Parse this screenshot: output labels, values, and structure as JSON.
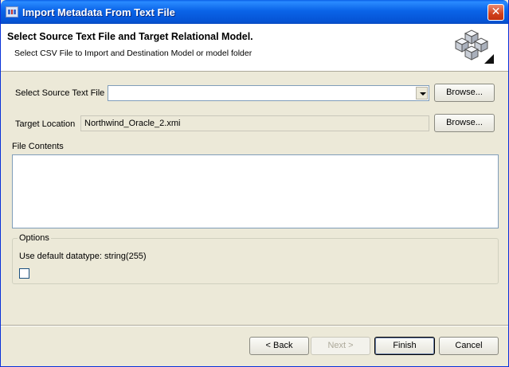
{
  "window": {
    "title": "Import Metadata From Text File",
    "close_glyph": "✕"
  },
  "banner": {
    "heading": "Select Source Text File and Target Relational Model.",
    "subtitle": "Select CSV File to Import and Destination Model or model folder",
    "icon": "cubes-icon"
  },
  "source": {
    "label": "Select Source Text File",
    "value": "",
    "browse_label": "Browse..."
  },
  "target": {
    "label": "Target Location",
    "value": "Northwind_Oracle_2.xmi",
    "browse_label": "Browse..."
  },
  "file_contents": {
    "label": "File Contents",
    "value": ""
  },
  "options": {
    "legend": "Options",
    "default_datatype_label": "Use default datatype: string(255)",
    "use_default_checked": false
  },
  "buttons": {
    "back": "< Back",
    "next": "Next >",
    "finish": "Finish",
    "cancel": "Cancel"
  }
}
